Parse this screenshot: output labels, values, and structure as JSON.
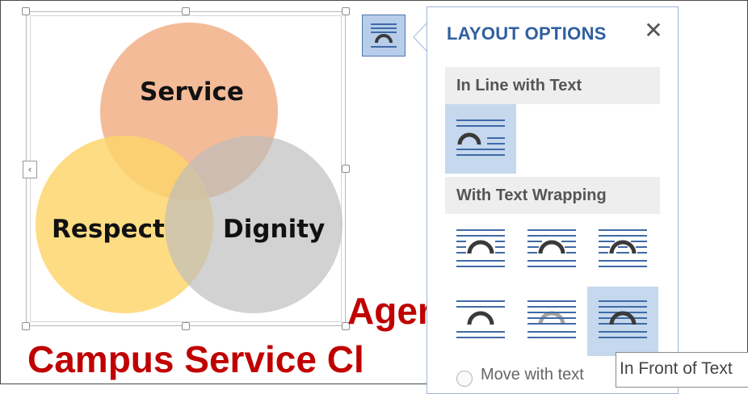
{
  "diagram": {
    "circles": [
      {
        "label": "Service",
        "color": "#f1a87c"
      },
      {
        "label": "Respect",
        "color": "#fcd469"
      },
      {
        "label": "Dignity",
        "color": "#bdbdbd"
      }
    ]
  },
  "document": {
    "heading_partial": "Ager",
    "subheading_partial": "Campus Service Cl",
    "text_color": "#c00000"
  },
  "layout_options": {
    "trigger_icon": "layout-options-icon",
    "title": "LAYOUT OPTIONS",
    "close_symbol": "✕",
    "section_inline": "In Line with Text",
    "section_wrapping": "With Text Wrapping",
    "options_inline": [
      {
        "icon": "in-line-with-text-icon",
        "selected": true
      }
    ],
    "options_wrapping": [
      {
        "icon": "square-wrap-icon",
        "selected": false
      },
      {
        "icon": "tight-wrap-icon",
        "selected": false
      },
      {
        "icon": "through-wrap-icon",
        "selected": false
      },
      {
        "icon": "top-and-bottom-wrap-icon",
        "selected": false
      },
      {
        "icon": "behind-text-icon",
        "selected": false
      },
      {
        "icon": "in-front-of-text-icon",
        "selected": true
      }
    ],
    "move_with_text_label": "Move with text",
    "accent_color": "#2f5f9f",
    "selected_color": "#c6d8ee"
  },
  "tooltip": {
    "text": "In Front of Text"
  }
}
